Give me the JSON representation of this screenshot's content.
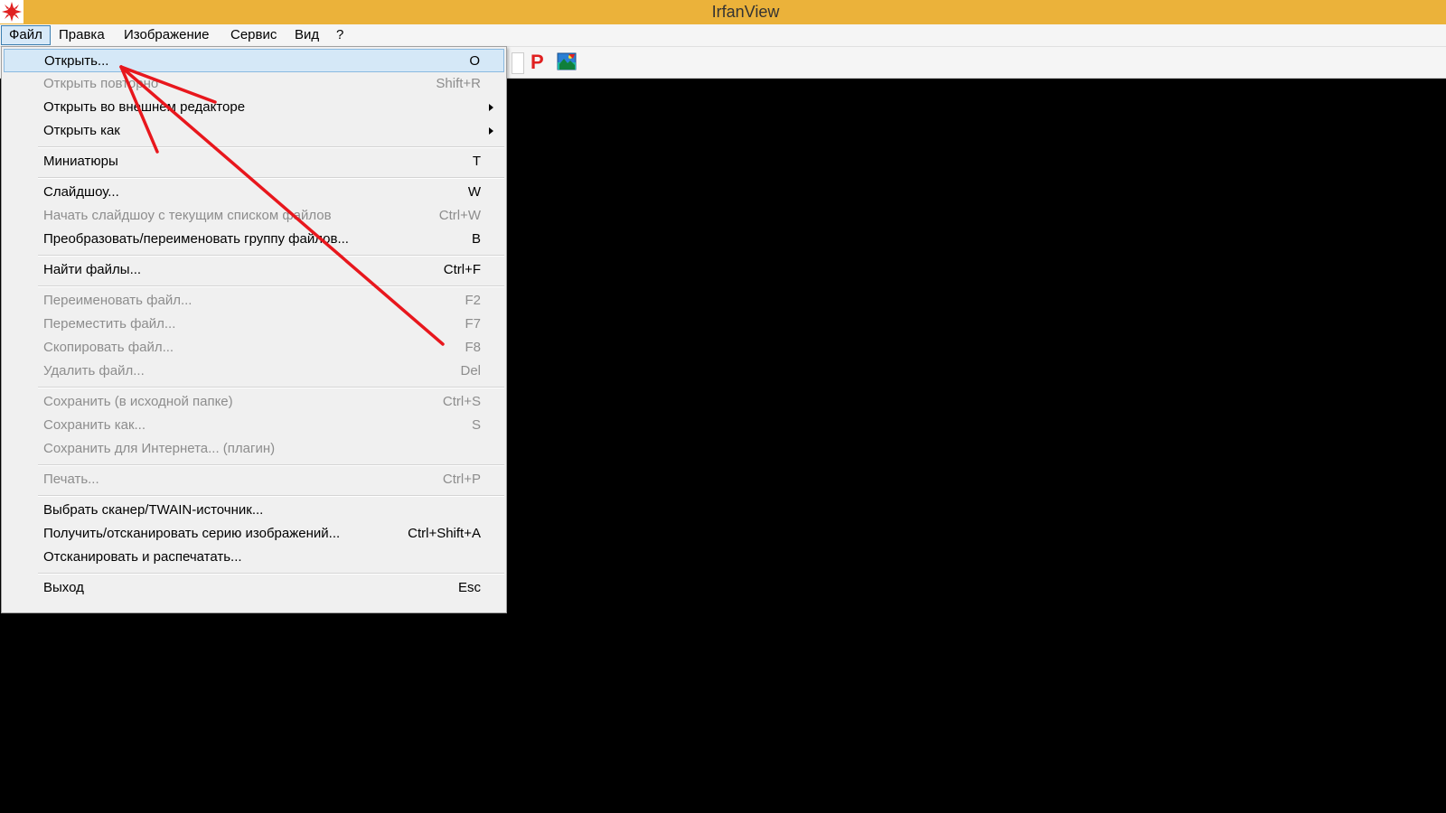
{
  "window": {
    "title": "IrfanView"
  },
  "menubar": {
    "items": [
      {
        "label": "Файл"
      },
      {
        "label": "Правка"
      },
      {
        "label": "Изображение"
      },
      {
        "label": "Сервис"
      },
      {
        "label": "Вид"
      },
      {
        "label": "?"
      }
    ]
  },
  "toolbar": {
    "p_label": "P",
    "icons": [
      "blank-icon",
      "p-icon",
      "image-icon"
    ]
  },
  "file_menu": {
    "items": [
      {
        "label": "Открыть...",
        "shortcut": "O",
        "enabled": true
      },
      {
        "label": "Открыть повторно",
        "shortcut": "Shift+R",
        "enabled": false
      },
      {
        "label": "Открыть во внешнем редакторе",
        "shortcut": "",
        "enabled": true,
        "submenu": true
      },
      {
        "label": "Открыть как",
        "shortcut": "",
        "enabled": true,
        "submenu": true
      },
      {
        "label": "Миниатюры",
        "shortcut": "T",
        "enabled": true
      },
      {
        "label": "Слайдшоу...",
        "shortcut": "W",
        "enabled": true
      },
      {
        "label": "Начать слайдшоу с текущим списком файлов",
        "shortcut": "Ctrl+W",
        "enabled": false
      },
      {
        "label": "Преобразовать/переименовать группу файлов...",
        "shortcut": "B",
        "enabled": true
      },
      {
        "label": "Найти файлы...",
        "shortcut": "Ctrl+F",
        "enabled": true
      },
      {
        "label": "Переименовать файл...",
        "shortcut": "F2",
        "enabled": false
      },
      {
        "label": "Переместить файл...",
        "shortcut": "F7",
        "enabled": false
      },
      {
        "label": "Скопировать файл...",
        "shortcut": "F8",
        "enabled": false
      },
      {
        "label": "Удалить файл...",
        "shortcut": "Del",
        "enabled": false
      },
      {
        "label": "Сохранить (в исходной папке)",
        "shortcut": "Ctrl+S",
        "enabled": false
      },
      {
        "label": "Сохранить как...",
        "shortcut": "S",
        "enabled": false
      },
      {
        "label": "Сохранить для Интернета... (плагин)",
        "shortcut": "",
        "enabled": false
      },
      {
        "label": "Печать...",
        "shortcut": "Ctrl+P",
        "enabled": false
      },
      {
        "label": "Выбрать сканер/TWAIN-источник...",
        "shortcut": "",
        "enabled": true
      },
      {
        "label": "Получить/отсканировать серию изображений...",
        "shortcut": "Ctrl+Shift+A",
        "enabled": true
      },
      {
        "label": "Отсканировать и распечатать...",
        "shortcut": "",
        "enabled": true
      },
      {
        "label": "Выход",
        "shortcut": "Esc",
        "enabled": true
      }
    ]
  },
  "colors": {
    "titlebar": "#ebb23a",
    "viewer_background": "#000000",
    "highlight": "#d5e8f7",
    "annotation_arrow": "#e8171d"
  }
}
